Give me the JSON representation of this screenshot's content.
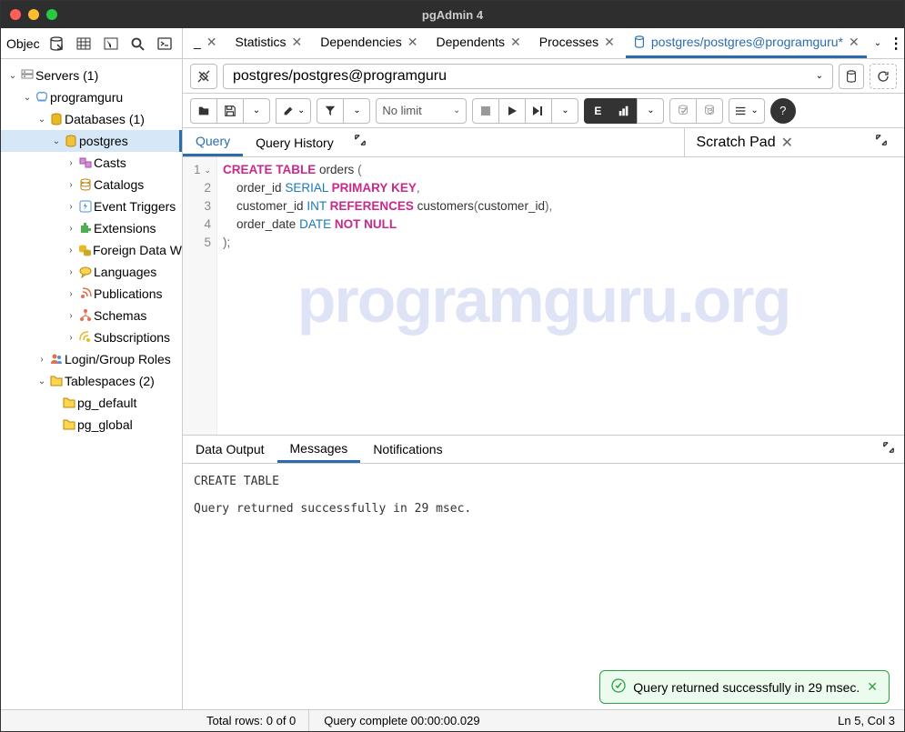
{
  "title": "pgAdmin 4",
  "sidebar": {
    "header": "Objec",
    "tree": {
      "servers": "Servers (1)",
      "server1": "programguru",
      "databases": "Databases (1)",
      "db": "postgres",
      "casts": "Casts",
      "catalogs": "Catalogs",
      "triggers": "Event Triggers",
      "ext": "Extensions",
      "fdw": "Foreign Data W",
      "langs": "Languages",
      "pubs": "Publications",
      "schemas": "Schemas",
      "subs": "Subscriptions",
      "roles": "Login/Group Roles",
      "tablespaces": "Tablespaces (2)",
      "ts1": "pg_default",
      "ts2": "pg_global"
    }
  },
  "tabs": {
    "stats": "Statistics",
    "deps": "Dependencies",
    "dependents": "Dependents",
    "processes": "Processes",
    "query": "postgres/postgres@programguru*"
  },
  "conn": {
    "value": "postgres/postgres@programguru"
  },
  "toolbar": {
    "limit": "No limit"
  },
  "editor_tabs": {
    "query": "Query",
    "history": "Query History",
    "scratch": "Scratch Pad"
  },
  "sql": {
    "l1a": "CREATE",
    "l1b": "TABLE",
    "l1c": "orders",
    "l2a": "order_id",
    "l2b": "SERIAL",
    "l2c": "PRIMARY",
    "l2d": "KEY",
    "l3a": "customer_id",
    "l3b": "INT",
    "l3c": "REFERENCES",
    "l3d": "customers",
    "l3e": "customer_id",
    "l4a": "order_date",
    "l4b": "DATE",
    "l4c": "NOT",
    "l4d": "NULL"
  },
  "output_tabs": {
    "data": "Data Output",
    "msgs": "Messages",
    "notif": "Notifications"
  },
  "output": "CREATE TABLE\n\nQuery returned successfully in 29 msec.",
  "toast": "Query returned successfully in 29 msec.",
  "status": {
    "rows": "Total rows: 0 of 0",
    "time": "Query complete 00:00:00.029",
    "pos": "Ln 5, Col 3"
  },
  "watermark": "programguru.org"
}
